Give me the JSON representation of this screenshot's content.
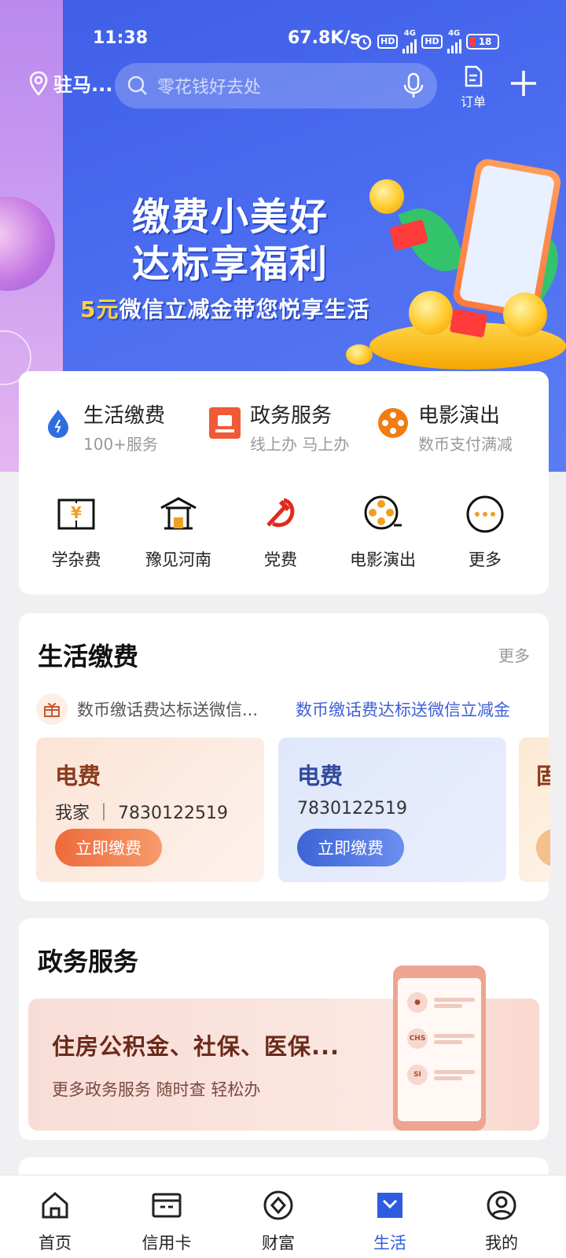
{
  "status_bar": {
    "time": "11:38",
    "speed": "67.8K/s",
    "battery": "18",
    "net1": "4G",
    "net2": "4G",
    "hd": "HD"
  },
  "top_bar": {
    "location": "驻马...",
    "search_placeholder": "零花钱好去处",
    "orders_label": "订单"
  },
  "banner": {
    "headline_line1": "缴费小美好",
    "headline_line2": "达标享福利",
    "subline_prefix": "5元",
    "subline_rest": "微信立减金带您悦享生活"
  },
  "quick_services": [
    {
      "title": "生活缴费",
      "subtitle": "100+服务",
      "icon": "water-drop-icon"
    },
    {
      "title": "政务服务",
      "subtitle": "线上办 马上办",
      "icon": "gov-badge-icon"
    },
    {
      "title": "电影演出",
      "subtitle": "数币支付满减",
      "icon": "film-reel-icon"
    }
  ],
  "grid_items": [
    {
      "label": "学杂费",
      "icon": "tuition-book-icon"
    },
    {
      "label": "豫见河南",
      "icon": "pavilion-icon"
    },
    {
      "label": "党费",
      "icon": "party-emblem-icon"
    },
    {
      "label": "电影演出",
      "icon": "film-reel-icon"
    },
    {
      "label": "更多",
      "icon": "more-dots-icon"
    }
  ],
  "life_payments": {
    "title": "生活缴费",
    "more": "更多",
    "promo_text_1": "数币缴话费达标送微信...",
    "promo_text_2": "数币缴话费达标送微信立减金",
    "bills": [
      {
        "type": "电费",
        "number": "我家 ｜ 7830122519",
        "button": "立即缴费"
      },
      {
        "type": "电费",
        "number": "7830122519",
        "button": "立即缴费"
      },
      {
        "type": "固",
        "number": "",
        "button": ""
      }
    ]
  },
  "gov_services": {
    "title": "政务服务",
    "headline": "住房公积金、社保、医保...",
    "subtitle": "更多政务服务 随时查 轻松办",
    "phone_tags": [
      "CHS",
      "SI"
    ]
  },
  "bottom_nav": [
    {
      "label": "首页",
      "icon": "home-icon",
      "active": false
    },
    {
      "label": "信用卡",
      "icon": "credit-card-icon",
      "active": false
    },
    {
      "label": "财富",
      "icon": "wealth-icon",
      "active": false
    },
    {
      "label": "生活",
      "icon": "life-icon",
      "active": true
    },
    {
      "label": "我的",
      "icon": "profile-icon",
      "active": false
    }
  ],
  "colors": {
    "primary_blue": "#2f5be0",
    "banner_blue": "#3f5fe7",
    "accent_orange": "#ee6a3c"
  }
}
